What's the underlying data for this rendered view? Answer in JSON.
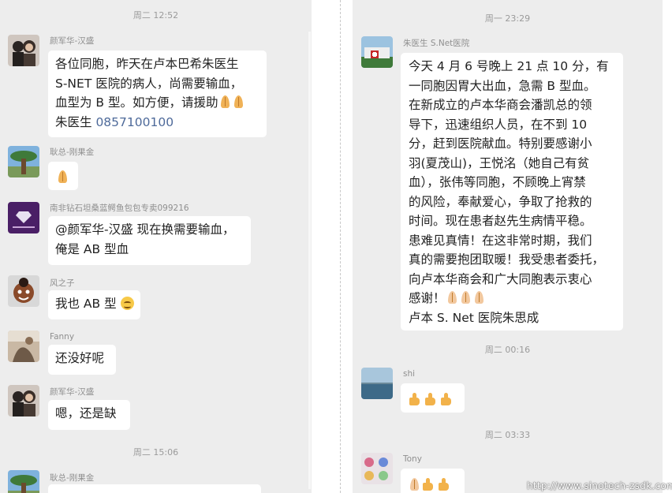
{
  "left_chat": {
    "timestamps": [
      "周二 12:52",
      "周二 15:06"
    ],
    "messages": [
      {
        "sender": "颜军华-汉盛",
        "lines": [
          "各位同胞，昨天在卢本巴希朱医生",
          "S-NET 医院的病人，尚需要输血，",
          "血型为 B 型。如方便，请援助"
        ],
        "line4_prefix": "朱医生 ",
        "phone": "0857100100"
      },
      {
        "sender": "耿总-刚果金"
      },
      {
        "sender": "南非钻石坦桑蓝鳄鱼包包专卖099216",
        "lines": [
          "@颜军华-汉盛  现在换需要输血，",
          "俺是 AB 型血"
        ]
      },
      {
        "sender": "风之子",
        "text": "我也 AB 型"
      },
      {
        "sender": "Fanny",
        "text": "还没好呢"
      },
      {
        "sender": "颜军华-汉盛",
        "text": "嗯，还是缺"
      },
      {
        "sender": "耿总-刚果金"
      }
    ]
  },
  "right_chat": {
    "timestamps": [
      "周一 23:29",
      "周二 00:16",
      "周二 03:33"
    ],
    "messages": [
      {
        "sender": "朱医生 S.Net医院",
        "lines": [
          "今天 4 月 6 号晚上 21 点 10 分，有",
          "一同胞因胃大出血，急需 B 型血。",
          "在新成立的卢本华商会潘凯总的领",
          "导下，迅速组织人员，在不到 10",
          "分，赶到医院献血。特别要感谢小",
          "羽(夏茂山)，王悦洺（她自己有贫",
          "血），张伟等同胞，不顾晚上宵禁",
          "的风险，奉献爱心，争取了抢救的",
          "时间。现在患者赵先生病情平稳。",
          "患难见真情！在这非常时期，我们",
          "真的需要抱团取暖！我受患者委托，",
          "向卢本华商会和广大同胞表示衷心",
          "感谢！"
        ],
        "signature": "卢本 S. Net 医院朱思成"
      },
      {
        "sender": "shi"
      },
      {
        "sender": "Tony"
      }
    ]
  },
  "watermark": "http://www.sinotech-zsdk.com",
  "colors": {
    "background": "#ededed",
    "bubble": "#ffffff",
    "link": "#4e6a9a",
    "timestamp": "#9a9a9a"
  }
}
